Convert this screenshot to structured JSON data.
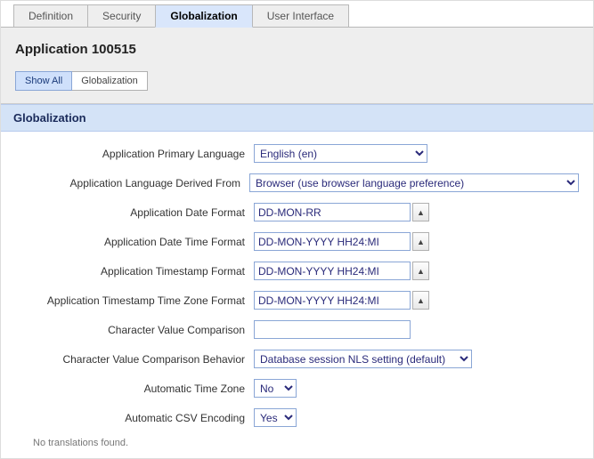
{
  "tabs": {
    "definition": "Definition",
    "security": "Security",
    "globalization": "Globalization",
    "user_interface": "User Interface"
  },
  "page_title": "Application 100515",
  "subtabs": {
    "show_all": "Show All",
    "globalization": "Globalization"
  },
  "section_header": "Globalization",
  "labels": {
    "primary_language": "Application Primary Language",
    "derived_from": "Application Language Derived From",
    "date_format": "Application Date Format",
    "date_time_format": "Application Date Time Format",
    "timestamp_format": "Application Timestamp Format",
    "timestamp_tz_format": "Application Timestamp Time Zone Format",
    "char_value_comparison": "Character Value Comparison",
    "char_value_comparison_behavior": "Character Value Comparison Behavior",
    "automatic_time_zone": "Automatic Time Zone",
    "automatic_csv_encoding": "Automatic CSV Encoding"
  },
  "values": {
    "primary_language": "English (en)",
    "derived_from": "Browser (use browser language preference)",
    "date_format": "DD-MON-RR",
    "date_time_format": "DD-MON-YYYY HH24:MI",
    "timestamp_format": "DD-MON-YYYY HH24:MI",
    "timestamp_tz_format": "DD-MON-YYYY HH24:MI",
    "char_value_comparison": "",
    "char_value_comparison_behavior": "Database session NLS setting (default)",
    "automatic_time_zone": "No",
    "automatic_csv_encoding": "Yes"
  },
  "note": "No translations found."
}
